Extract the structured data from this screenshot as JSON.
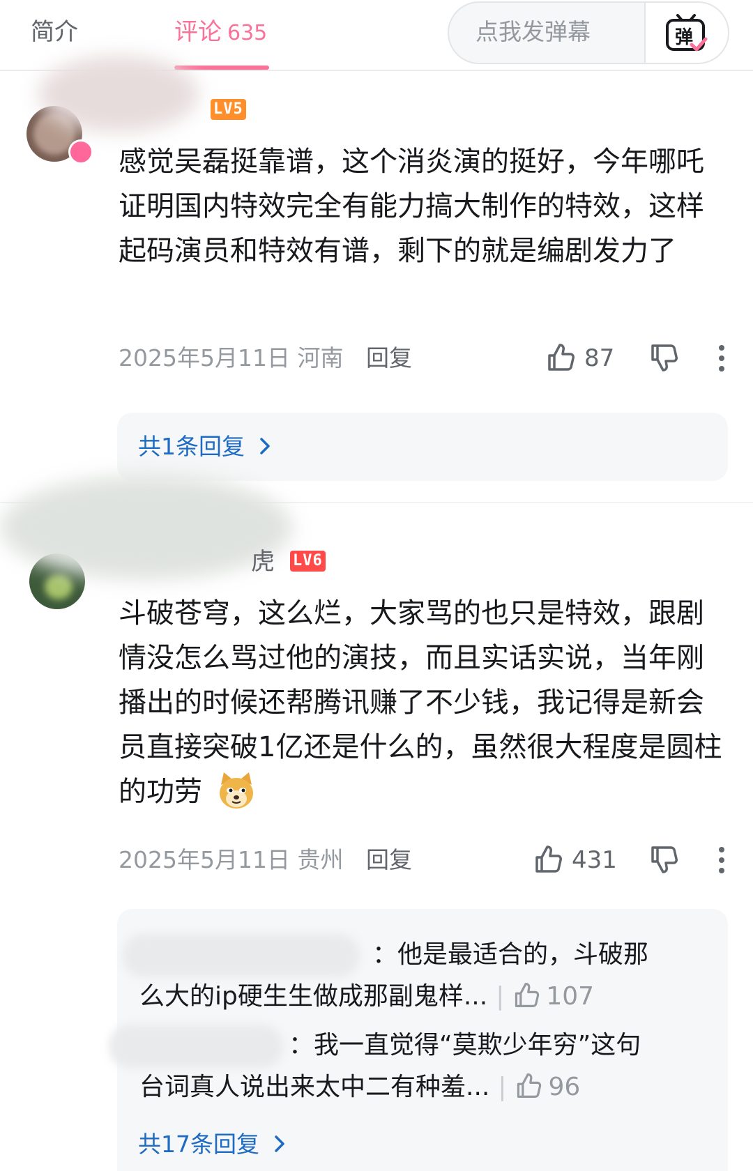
{
  "tabs": {
    "intro": "简介",
    "comments": "评论",
    "comments_count": "635"
  },
  "danmaku": {
    "placeholder": "点我发弹幕",
    "button_glyph": "弹",
    "icon": "danmaku-tv-icon"
  },
  "colors": {
    "accent_pink": "#fb7299",
    "link_blue": "#1e6bc2",
    "level_orange": "#ff8f2a",
    "level_red": "#ff4a4a"
  },
  "comments": [
    {
      "username_visible": "",
      "level": "LV5",
      "content": "感觉吴磊挺靠谱，这个消炎演的挺好，今年哪吒证明国内特效完全有能力搞大制作的特效，这样起码演员和特效有谱，剩下的就是编剧发力了",
      "date": "2025年5月11日",
      "location": "河南",
      "reply_label": "回复",
      "likes": "87",
      "replies_summary": "共1条回复",
      "sub_replies": []
    },
    {
      "username_visible": "虎",
      "level": "LV6",
      "content": "斗破苍穹，这么烂，大家骂的也只是特效，跟剧情没怎么骂过他的演技，而且实话实说，当年刚播出的时候还帮腾讯赚了不少钱，我记得是新会员直接突破1亿还是什么的，虽然很大程度是圆柱的功劳",
      "emoji": "doge-emoji",
      "date": "2025年5月11日",
      "location": "贵州",
      "reply_label": "回复",
      "likes": "431",
      "replies_summary": "共17条回复",
      "sub_replies": [
        {
          "line1": "：他是最适合的，斗破那",
          "line2": "么大的ip硬生生做成那副鬼样...",
          "likes": "107"
        },
        {
          "line1": "：我一直觉得“莫欺少年穷”这句",
          "line2": "台词真人说出来太中二有种羞...",
          "likes": "96"
        }
      ]
    }
  ]
}
